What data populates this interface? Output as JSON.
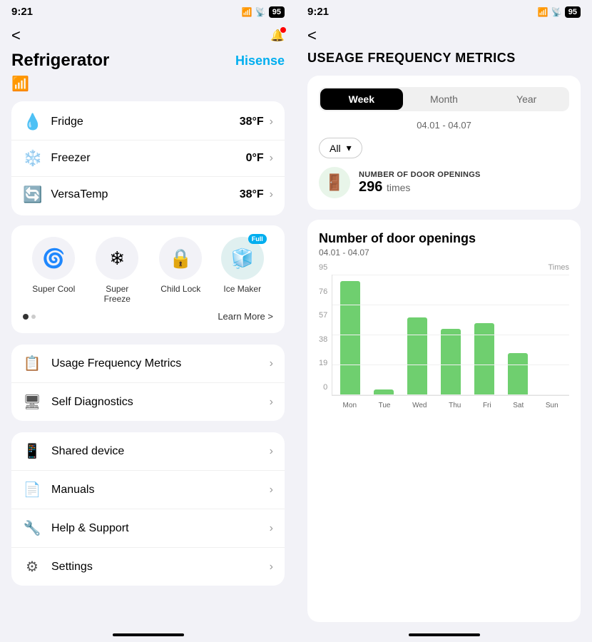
{
  "left": {
    "status": {
      "time": "9:21",
      "battery": "95"
    },
    "header": {
      "back_label": "<",
      "title": "Refrigerator",
      "brand": "Hisense"
    },
    "temperatures": [
      {
        "id": "fridge",
        "icon": "💧",
        "label": "Fridge",
        "value": "38°F"
      },
      {
        "id": "freezer",
        "icon": "❄️",
        "label": "Freezer",
        "value": "0°F"
      },
      {
        "id": "versatemp",
        "icon": "🔄",
        "label": "VersaTemp",
        "value": "38°F"
      }
    ],
    "features": [
      {
        "id": "super-cool",
        "icon": "🌀",
        "label": "Super Cool",
        "badge": null,
        "active": false
      },
      {
        "id": "super-freeze",
        "icon": "❄",
        "label": "Super\nFreeze",
        "badge": null,
        "active": false
      },
      {
        "id": "child-lock",
        "icon": "🔒",
        "label": "Child Lock",
        "badge": null,
        "active": false
      },
      {
        "id": "ice-maker",
        "icon": "🧊",
        "label": "Ice Maker",
        "badge": "Full",
        "active": true
      }
    ],
    "learn_more_label": "Learn More >",
    "diagnostics_menu": [
      {
        "id": "usage-frequency",
        "icon": "📋",
        "label": "Usage Frequency Metrics"
      },
      {
        "id": "self-diagnostics",
        "icon": "🖥",
        "label": "Self Diagnostics"
      }
    ],
    "settings_menu": [
      {
        "id": "shared-device",
        "icon": "📱",
        "label": "Shared device"
      },
      {
        "id": "manuals",
        "icon": "📄",
        "label": "Manuals"
      },
      {
        "id": "help-support",
        "icon": "🔧",
        "label": "Help & Support"
      },
      {
        "id": "settings",
        "icon": "⚙",
        "label": "Settings"
      }
    ]
  },
  "right": {
    "status": {
      "time": "9:21",
      "battery": "95"
    },
    "header": {
      "back_label": "<",
      "title": "USEAGE FREQUENCY METRICS"
    },
    "tabs": [
      "Week",
      "Month",
      "Year"
    ],
    "active_tab": "Week",
    "date_range": "04.01 - 04.07",
    "dropdown": {
      "value": "All",
      "label": "All"
    },
    "door_openings": {
      "label": "NUMBER OF DOOR OPENINGS",
      "count": "296",
      "unit": "times"
    },
    "chart": {
      "title": "Number of door openings",
      "date_range": "04.01 - 04.07",
      "y_axis_label": "Times",
      "y_labels": [
        "95",
        "76",
        "57",
        "38",
        "19",
        "0"
      ],
      "bars": [
        {
          "day": "Mon",
          "value": 95,
          "height_pct": 100
        },
        {
          "day": "Tue",
          "value": 5,
          "height_pct": 5
        },
        {
          "day": "Wed",
          "value": 65,
          "height_pct": 68
        },
        {
          "day": "Thu",
          "value": 55,
          "height_pct": 58
        },
        {
          "day": "Fri",
          "value": 60,
          "height_pct": 63
        },
        {
          "day": "Sat",
          "value": 35,
          "height_pct": 37
        },
        {
          "day": "Sun",
          "value": 0,
          "height_pct": 0
        }
      ]
    }
  }
}
